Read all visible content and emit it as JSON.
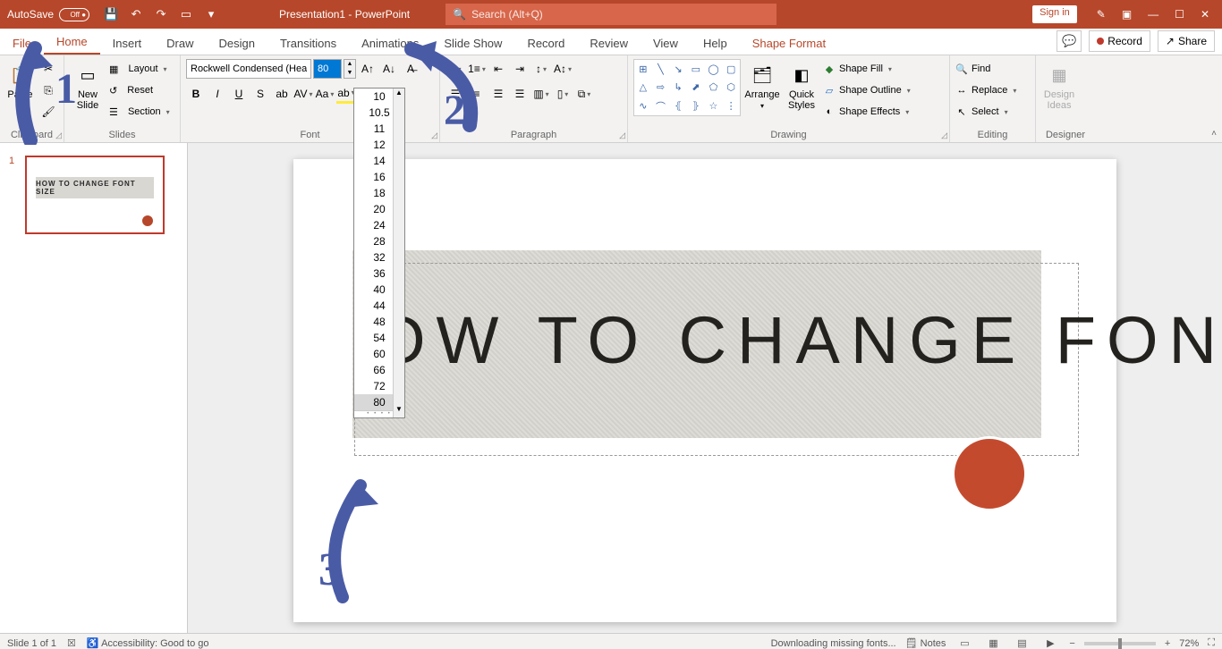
{
  "titlebar": {
    "autosave_label": "AutoSave",
    "autosave_state": "Off",
    "doc_title": "Presentation1 - PowerPoint",
    "search_placeholder": "Search (Alt+Q)",
    "signin": "Sign in"
  },
  "tabs": {
    "file": "File",
    "items": [
      "Home",
      "Insert",
      "Draw",
      "Design",
      "Transitions",
      "Animations",
      "Slide Show",
      "Record",
      "Review",
      "View",
      "Help",
      "Shape Format"
    ],
    "active": "Home",
    "record": "Record",
    "share": "Share"
  },
  "ribbon": {
    "clipboard": {
      "label": "Clipboard",
      "paste": "Paste"
    },
    "slides": {
      "label": "Slides",
      "new_slide": "New\nSlide",
      "layout": "Layout",
      "reset": "Reset",
      "section": "Section"
    },
    "font": {
      "label": "Font",
      "name": "Rockwell Condensed (Hea",
      "size": "80",
      "sizes": [
        "10",
        "10.5",
        "11",
        "12",
        "14",
        "16",
        "18",
        "20",
        "24",
        "28",
        "32",
        "36",
        "40",
        "44",
        "48",
        "54",
        "60",
        "66",
        "72",
        "80"
      ],
      "selected_size": "80"
    },
    "paragraph": {
      "label": "Paragraph"
    },
    "drawing": {
      "label": "Drawing",
      "arrange": "Arrange",
      "quick_styles": "Quick\nStyles",
      "shape_fill": "Shape Fill",
      "shape_outline": "Shape Outline",
      "shape_effects": "Shape Effects"
    },
    "editing": {
      "label": "Editing",
      "find": "Find",
      "replace": "Replace",
      "select": "Select"
    },
    "designer": {
      "label": "Designer",
      "ideas": "Design\nIdeas"
    }
  },
  "slide_panel": {
    "number": "1",
    "thumb_text": "HOW TO CHANGE FONT SIZE"
  },
  "slide": {
    "headline": "OW  TO  CHANGE  FONT  SIZE"
  },
  "annotations": {
    "n1": "1",
    "n2": "2",
    "n3": "3"
  },
  "statusbar": {
    "slide_of": "Slide 1 of 1",
    "accessibility": "Accessibility: Good to go",
    "downloading": "Downloading missing fonts...",
    "notes": "Notes",
    "zoom": "72%"
  }
}
